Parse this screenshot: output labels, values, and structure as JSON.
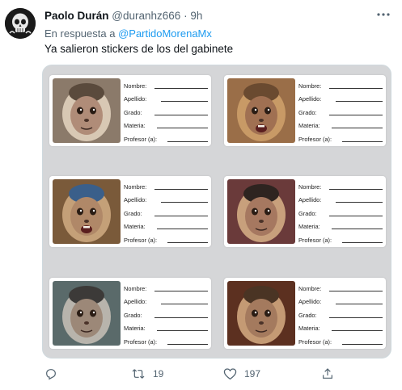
{
  "tweet": {
    "author_name": "Paolo Durán",
    "handle": "@duranhz666",
    "separator": "·",
    "time": "9h",
    "reply_prefix": "En respuesta a",
    "reply_to": "@PartidoMorenaMx",
    "text": "Ya salieron stickers de los del gabinete"
  },
  "stickers": {
    "fields": [
      "Nombre:",
      "Apellido:",
      "Grado:",
      "Materia:",
      "Profesor (a):"
    ]
  },
  "actions": {
    "retweets": "19",
    "likes": "197"
  },
  "colors": {
    "link": "#1d9bf0",
    "secondary_text": "#536471",
    "media_background": "#d5d6d8"
  },
  "icons": [
    "more-icon",
    "reply-icon",
    "retweet-icon",
    "like-icon",
    "share-icon"
  ]
}
